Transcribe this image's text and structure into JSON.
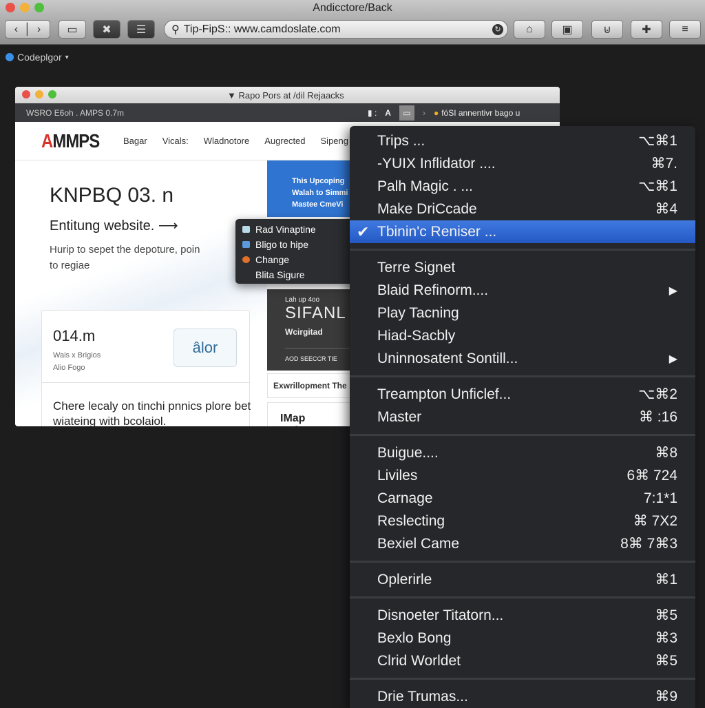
{
  "window": {
    "title": "Andicctore/Back",
    "url": "Tip-FipS:: www.camdoslate.com"
  },
  "bookmarks": {
    "label": "Codeplgor"
  },
  "inner": {
    "title": "Rapo Pors at /dil Rejaacks",
    "bar_left": "WSRO E6oh  . AMPS 0.7m",
    "bar_right": "fóSI annentivr bago u",
    "logo": {
      "a": "A",
      "rest": "MMPS"
    },
    "nav": [
      "Bagar",
      "Vicals:",
      "Wladnotore",
      "Augrected",
      "Sipeng"
    ],
    "hero": {
      "title": "KNPBQ 03. n",
      "subtitle": "Entitung website.",
      "arrow": "⟶",
      "text": "Hurip to sepet the depoture, poin to regiae"
    },
    "card": {
      "value": "014.m",
      "sub1": "Wais x Brigios",
      "sub2": "Alio Fogo",
      "button": "âlor",
      "body": "Chere lecaly on tinchi pnnics plore bet wiateing with bcolaiol."
    },
    "blue": [
      "This Upcoping",
      "Walah to Simmi",
      "Mastee CmeVi"
    ],
    "dark": {
      "small": "Lah up 4oo",
      "big": "SIFANL",
      "w": "Wcirgitad",
      "a": "AOD SEECCR TIE"
    },
    "wc1": "Exwrillopment The",
    "wc2": "IMap Eefsac"
  },
  "popup": [
    {
      "label": "Rad Vinaptine",
      "color": "#b8dbe9"
    },
    {
      "label": "Bligo to hipe",
      "color": "#5b9bdc"
    },
    {
      "label": "Change",
      "color": "#e0702a"
    },
    {
      "label": "Blita Sigure",
      "color": ""
    }
  ],
  "menu": [
    [
      {
        "label": "Trips ...",
        "shortcut": "⌥⌘1"
      },
      {
        "label": "-YUIX Inflidator ....",
        "shortcut": "⌘7."
      },
      {
        "label": "Palh Magic . ...",
        "shortcut": "⌥⌘1"
      },
      {
        "label": "Make DriCcade",
        "shortcut": "⌘4"
      },
      {
        "label": "Tbinin'c Reniser ...",
        "shortcut": "",
        "checked": true,
        "selected": true
      }
    ],
    [
      {
        "label": "Terre Signet"
      },
      {
        "label": "Blaid Refinorm....",
        "submenu": true
      },
      {
        "label": "Play Tacning"
      },
      {
        "label": "Hiad-Sacbly"
      },
      {
        "label": "Uninnosatent Sontill...",
        "submenu": true
      }
    ],
    [
      {
        "label": "Treampton Unficlef...",
        "shortcut": "⌥⌘2"
      },
      {
        "label": "Master",
        "shortcut": "⌘ :16"
      }
    ],
    [
      {
        "label": "Buigue....",
        "shortcut": "⌘8"
      },
      {
        "label": "Liviles",
        "shortcut": "6⌘ 724"
      },
      {
        "label": "Carnage",
        "shortcut": "7:1*1"
      },
      {
        "label": "Reslecting",
        "shortcut": "⌘ 7X2"
      },
      {
        "label": "Bexiel Came",
        "shortcut": "8⌘ 7⌘3"
      }
    ],
    [
      {
        "label": "Oplerirle",
        "shortcut": "⌘1"
      }
    ],
    [
      {
        "label": "Disnoeter Titatorn...",
        "shortcut": "⌘5"
      },
      {
        "label": "Bexlo Bong",
        "shortcut": "⌘3"
      },
      {
        "label": "Clrid Worldet",
        "shortcut": "⌘5"
      }
    ],
    [
      {
        "label": "Drie Trumas...",
        "shortcut": "⌘9"
      }
    ]
  ],
  "colors": {
    "menu_bg": "#26272b",
    "highlight": "#2f6bd6",
    "brand_red": "#d9322b",
    "panel_blue": "#2f74d0"
  }
}
